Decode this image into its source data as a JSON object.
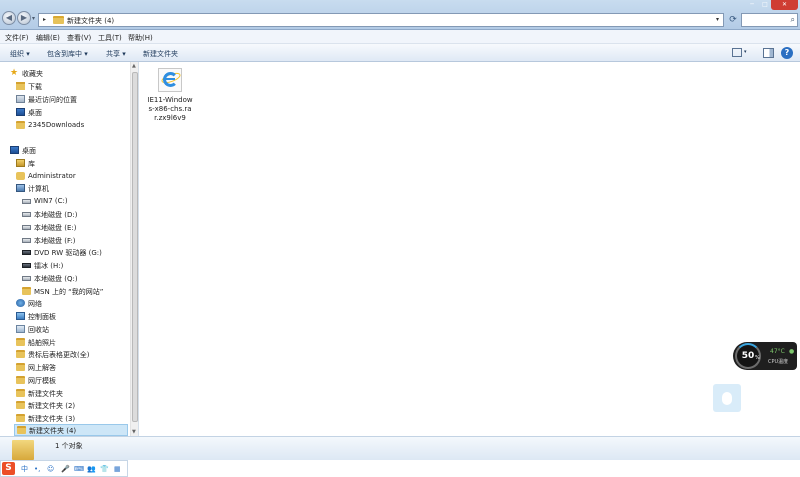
{
  "window": {
    "address_path": "新建文件夹 (4)",
    "nav_back": "◀",
    "nav_forward": "▶",
    "refresh_glyph": "⟳",
    "search_glyph": "⌕",
    "min_glyph": "─",
    "max_glyph": "□",
    "close_glyph": "✕"
  },
  "menubar": {
    "items": [
      "文件(F)",
      "编辑(E)",
      "查看(V)",
      "工具(T)",
      "帮助(H)"
    ]
  },
  "toolbar": {
    "organize": "组织 ▾",
    "include_library": "包含到库中 ▾",
    "share": "共享 ▾",
    "new_folder": "新建文件夹",
    "help_glyph": "?"
  },
  "nav": {
    "favorites_title": "收藏夹",
    "favorites": [
      "下载",
      "最近访问的位置",
      "桌面",
      "2345Downloads"
    ],
    "desktop": "桌面",
    "library": "库",
    "administrator": "Administrator",
    "computer": "计算机",
    "drives": [
      "WIN7 (C:)",
      "本地磁盘 (D:)",
      "本地磁盘 (E:)",
      "本地磁盘 (F:)",
      "DVD RW 驱动器 (G:)",
      "镭冰 (H:)",
      "本地磁盘 (Q:)",
      "MSN 上的 “我的网站”"
    ],
    "network": "网络",
    "control_panel": "控制面板",
    "recycle_bin": "回收站",
    "folders": [
      "船舶照片",
      "贵标后表格更改(全)",
      "网上解答",
      "网厅模板",
      "新建文件夹",
      "新建文件夹 (2)",
      "新建文件夹 (3)",
      "新建文件夹 (4)"
    ],
    "scroll_up": "▲",
    "scroll_down": "▼"
  },
  "content": {
    "files": [
      {
        "name": "IE11-Windows-x86-chs.rar.zx9l6v9"
      }
    ]
  },
  "cpu_widget": {
    "percent": "50",
    "percent_sign": "%",
    "temperature": "47°C",
    "label": "CPU温度",
    "leaf": "💧"
  },
  "details": {
    "count": "1 个对象"
  },
  "ime": {
    "logo": "S",
    "items": [
      "中",
      "•,",
      "☺",
      "🎤",
      "⌨",
      "👥",
      "👕",
      "▦"
    ]
  }
}
